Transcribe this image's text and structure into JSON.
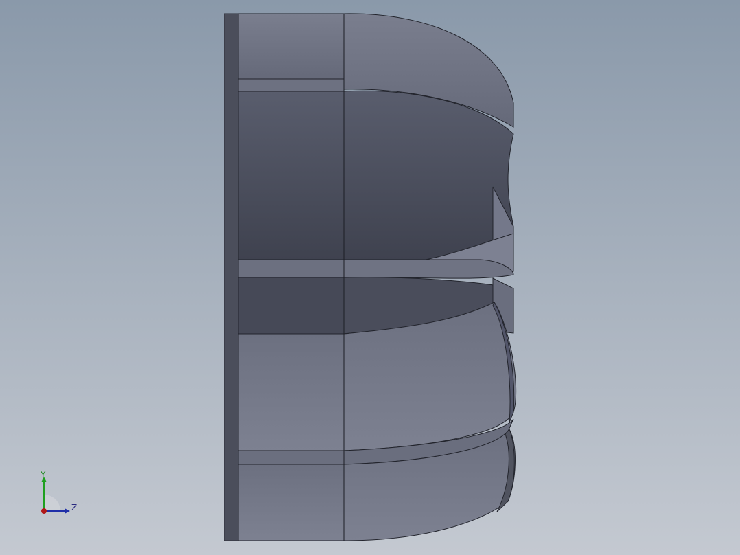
{
  "viewport": {
    "background_top": "#8b9aab",
    "background_bottom": "#c3c8d0",
    "model_color": "#5e6271"
  },
  "triad": {
    "y_label": "Y",
    "z_label": "Z",
    "y_color": "#1fa01f",
    "z_color": "#1f2fa8",
    "origin_color": "#b01818"
  }
}
